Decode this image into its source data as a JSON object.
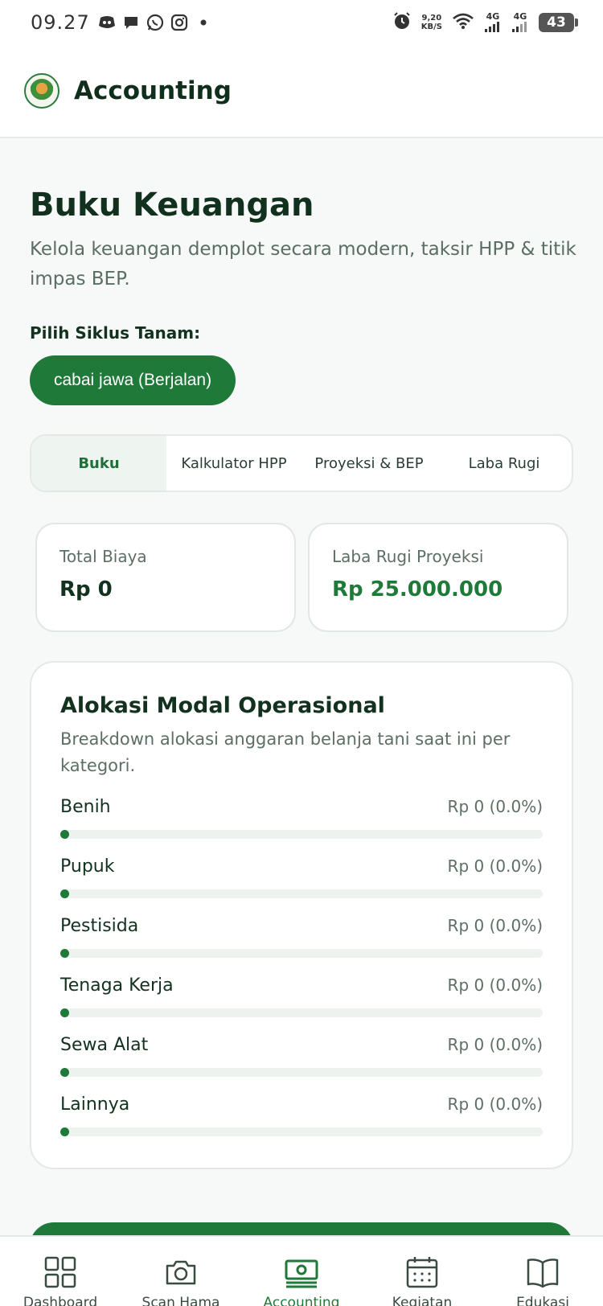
{
  "status_bar": {
    "time": "09.27",
    "speed_value": "9,20",
    "speed_unit": "KB/S",
    "net1": "4G",
    "net2": "4G",
    "battery": "43",
    "notif_icons": [
      "discord-icon",
      "chat-icon",
      "whatsapp-icon",
      "instagram-icon",
      "dot-icon"
    ]
  },
  "app": {
    "title": "Accounting"
  },
  "page": {
    "title": "Buku Keuangan",
    "subtitle": "Kelola keuangan demplot secara modern, taksir HPP & titik impas BEP.",
    "cycle_label": "Pilih Siklus Tanam:",
    "cycle_selected": "cabai jawa (Berjalan)"
  },
  "tabs": [
    {
      "label": "Buku",
      "active": true
    },
    {
      "label": "Kalkulator HPP",
      "active": false
    },
    {
      "label": "Proyeksi & BEP",
      "active": false
    },
    {
      "label": "Laba Rugi",
      "active": false
    }
  ],
  "stats": {
    "total_biaya_label": "Total Biaya",
    "total_biaya_value": "Rp 0",
    "laba_rugi_label": "Laba Rugi Proyeksi",
    "laba_rugi_value": "Rp 25.000.000"
  },
  "allocation": {
    "title": "Alokasi Modal Operasional",
    "subtitle": "Breakdown alokasi anggaran belanja tani saat ini per kategori.",
    "items": [
      {
        "name": "Benih",
        "value": "Rp 0 (0.0%)",
        "percent": 0
      },
      {
        "name": "Pupuk",
        "value": "Rp 0 (0.0%)",
        "percent": 0
      },
      {
        "name": "Pestisida",
        "value": "Rp 0 (0.0%)",
        "percent": 0
      },
      {
        "name": "Tenaga Kerja",
        "value": "Rp 0 (0.0%)",
        "percent": 0
      },
      {
        "name": "Sewa Alat",
        "value": "Rp 0 (0.0%)",
        "percent": 0
      },
      {
        "name": "Lainnya",
        "value": "Rp 0 (0.0%)",
        "percent": 0
      }
    ]
  },
  "bottom_nav": [
    {
      "label": "Dashboard",
      "icon": "grid-icon",
      "active": false
    },
    {
      "label": "Scan Hama",
      "icon": "camera-icon",
      "active": false
    },
    {
      "label": "Accounting",
      "icon": "money-icon",
      "active": true
    },
    {
      "label": "Kegiatan",
      "icon": "calendar-icon",
      "active": false
    },
    {
      "label": "Edukasi",
      "icon": "book-icon",
      "active": false
    }
  ],
  "colors": {
    "primary": "#1f7a3a",
    "text_dark": "#12321f",
    "text_muted": "#5d6f64",
    "background": "#f6f9f7"
  }
}
